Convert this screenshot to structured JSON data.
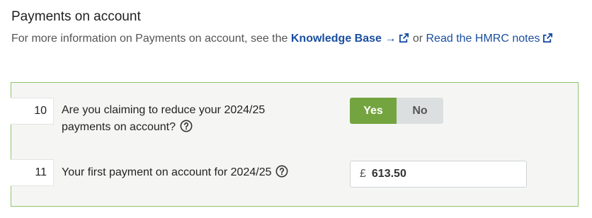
{
  "section": {
    "title": "Payments on account",
    "info_prefix": "For more information on Payments on account, see the",
    "kb_link": "Knowledge Base →",
    "between": "or",
    "hmrc_link": "Read the HMRC notes"
  },
  "questions": [
    {
      "number": "10",
      "text_line1": "Are you claiming to reduce your 2024/25",
      "text_line2": "payments on account?",
      "options": [
        "Yes",
        "No"
      ],
      "selected": "Yes"
    },
    {
      "number": "11",
      "text": "Your first payment on account for 2024/25",
      "currency": "£",
      "value": "613.50"
    }
  ],
  "colors": {
    "accent_green": "#74a43f",
    "panel_border": "#8fc56b",
    "link_blue": "#1a4fa0"
  }
}
